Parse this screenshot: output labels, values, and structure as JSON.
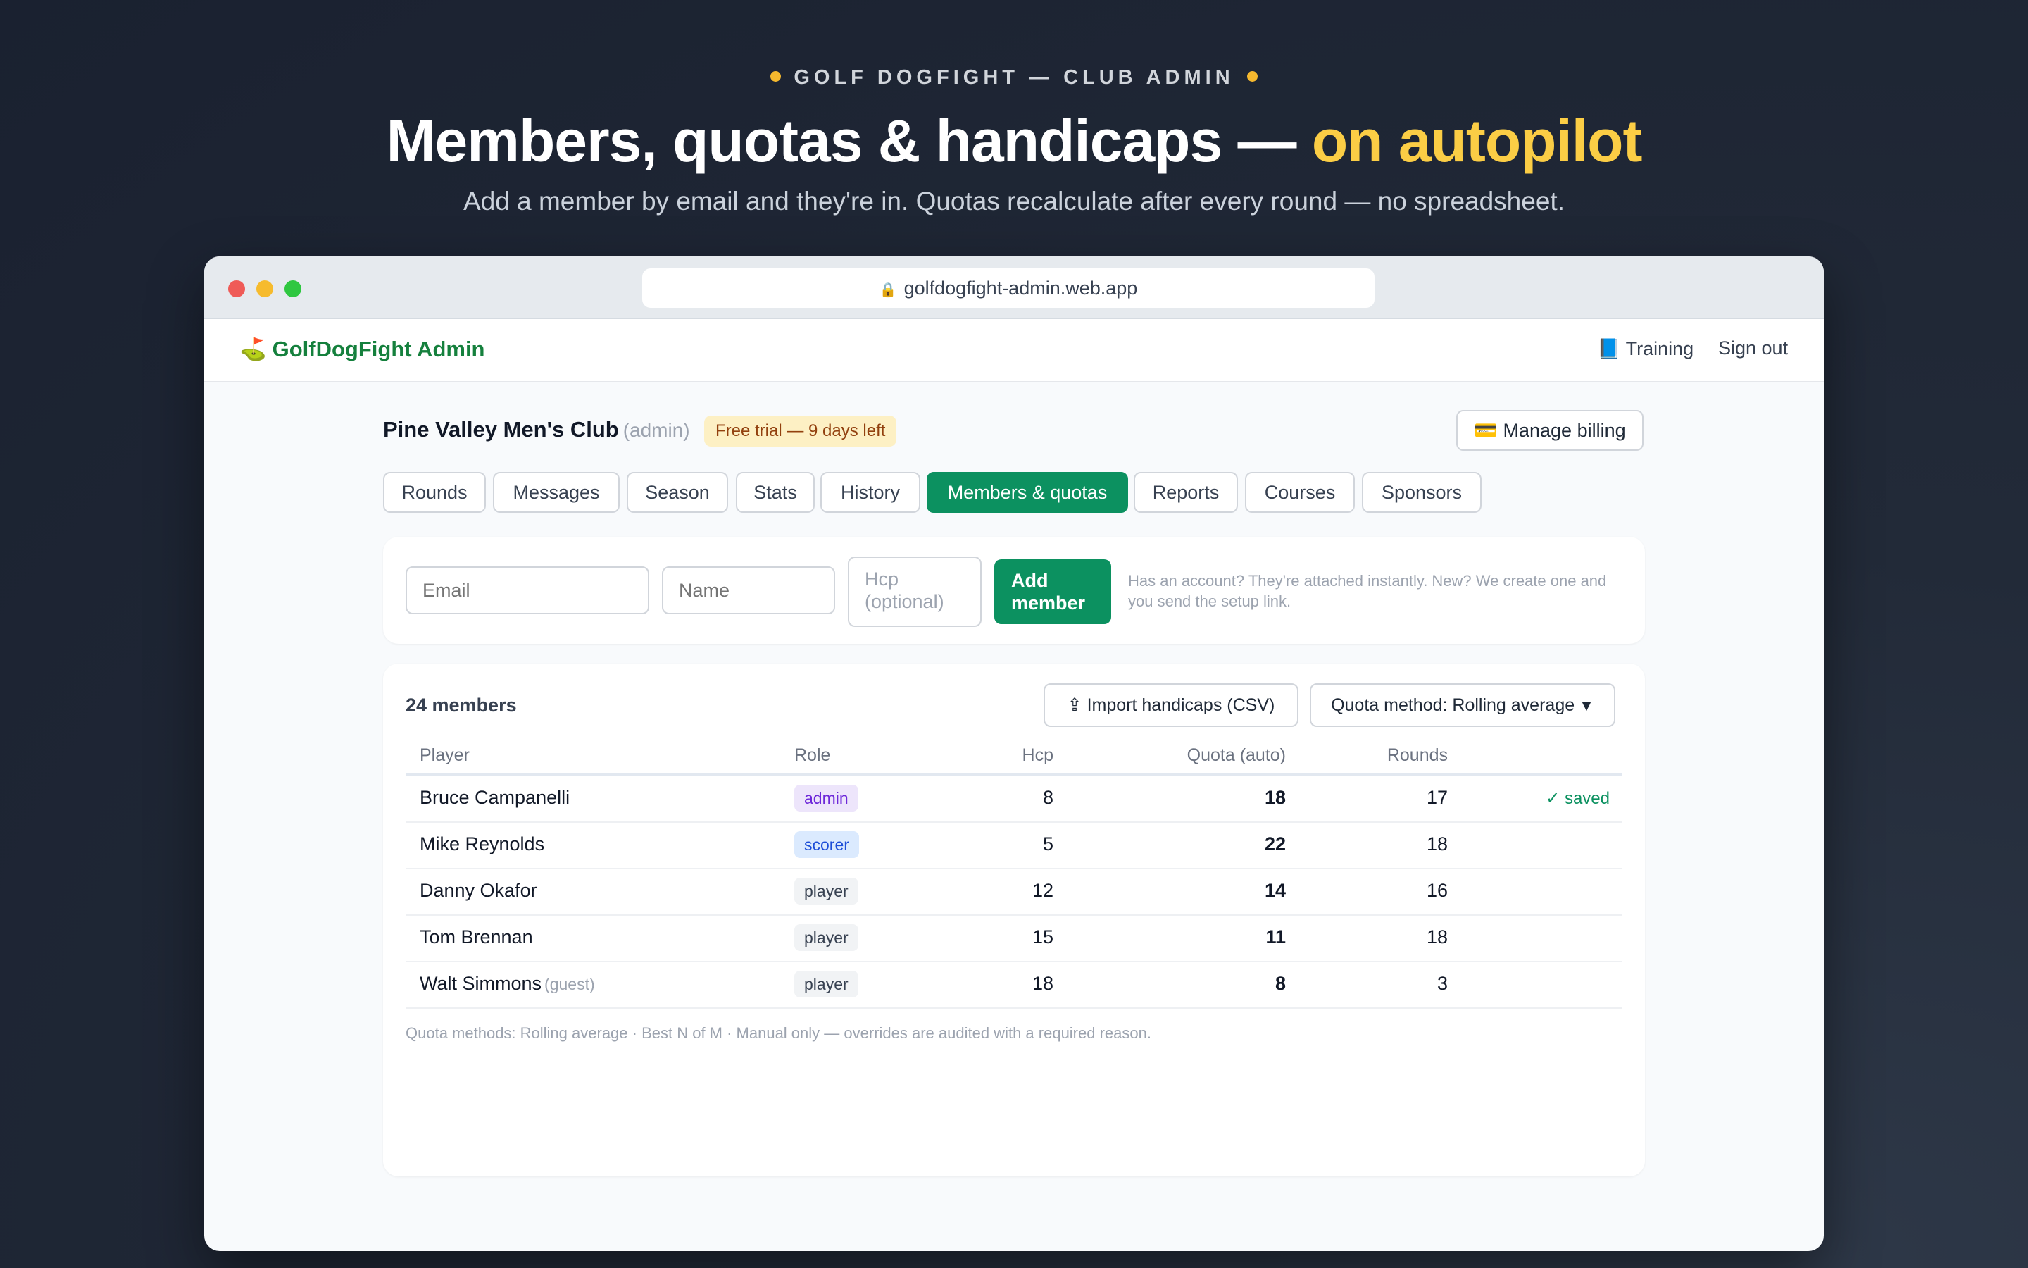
{
  "hero": {
    "eyebrow": "GOLF DOGFIGHT — CLUB ADMIN",
    "headline_main": "Members, quotas & handicaps — ",
    "headline_accent": "on autopilot",
    "subhead": "Add a member by email and they're in. Quotas recalculate after every round — no spreadsheet."
  },
  "browser": {
    "url": "golfdogfight-admin.web.app"
  },
  "nav": {
    "brand": "GolfDogFight Admin",
    "training": "Training",
    "sign_out": "Sign out"
  },
  "club": {
    "name": "Pine Valley Men's Club",
    "role": "(admin)",
    "trial": "Free trial — 9 days left",
    "billing": "Manage billing"
  },
  "tabs": [
    "Rounds",
    "Messages",
    "Season",
    "Stats",
    "History",
    "Members & quotas",
    "Reports",
    "Courses",
    "Sponsors"
  ],
  "active_tab": "Members & quotas",
  "add_form": {
    "email_placeholder": "Email",
    "name_placeholder": "Name",
    "hcp_placeholder": "Hcp (optional)",
    "add_line1": "Add",
    "add_line2": "member",
    "hint": "Has an account? They're attached instantly. New? We create one and you send the setup link."
  },
  "members": {
    "count": "24 members",
    "import": "Import handicaps (CSV)",
    "quota_method": "Quota method: Rolling average",
    "columns": {
      "player": "Player",
      "role": "Role",
      "hcp": "Hcp",
      "quota": "Quota (auto)",
      "rounds": "Rounds"
    },
    "rows": [
      {
        "player": "Bruce Campanelli",
        "guest": "",
        "role": "admin",
        "hcp": "8",
        "quota": "18",
        "rounds": "17",
        "status": "✓ saved"
      },
      {
        "player": "Mike Reynolds",
        "guest": "",
        "role": "scorer",
        "hcp": "5",
        "quota": "22",
        "rounds": "18",
        "status": ""
      },
      {
        "player": "Danny Okafor",
        "guest": "",
        "role": "player",
        "hcp": "12",
        "quota": "14",
        "rounds": "16",
        "status": ""
      },
      {
        "player": "Tom Brennan",
        "guest": "",
        "role": "player",
        "hcp": "15",
        "quota": "11",
        "rounds": "18",
        "status": ""
      },
      {
        "player": "Walt Simmons",
        "guest": "(guest)",
        "role": "player",
        "hcp": "18",
        "quota": "8",
        "rounds": "3",
        "status": ""
      }
    ],
    "footnote": "Quota methods: Rolling average · Best N of M · Manual only — overrides are audited with a required reason."
  },
  "colors": {
    "accent_green": "#0c9160",
    "headline_accent": "#fbcd45",
    "trial_bg": "#fdf0c4"
  },
  "icons": {
    "lock": "lock-icon",
    "flag": "golf-flag-icon",
    "book": "book-icon",
    "card": "credit-card-icon",
    "upload": "upload-icon",
    "chevron": "chevron-down-icon"
  }
}
